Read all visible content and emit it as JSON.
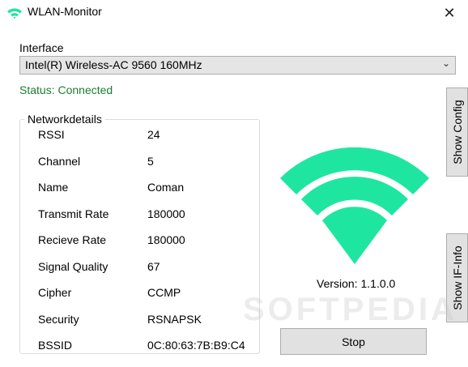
{
  "window": {
    "title": "WLAN-Monitor",
    "close_glyph": "✕"
  },
  "interface": {
    "label": "Interface",
    "selected": "Intel(R) Wireless-AC 9560 160MHz",
    "chevron": "⌄"
  },
  "status": {
    "text": "Status: Connected",
    "color": "#1b7f2c"
  },
  "details": {
    "legend": "Networkdetails",
    "rows": [
      {
        "label": "RSSI",
        "value": "24"
      },
      {
        "label": "Channel",
        "value": "5"
      },
      {
        "label": "Name",
        "value": "Coman"
      },
      {
        "label": "Transmit Rate",
        "value": "180000"
      },
      {
        "label": "Recieve Rate",
        "value": "180000"
      },
      {
        "label": "Signal Quality",
        "value": "67"
      },
      {
        "label": "Cipher",
        "value": "CCMP"
      },
      {
        "label": "Security",
        "value": "RSNAPSK"
      },
      {
        "label": "BSSID",
        "value": "0C:80:63:7B:B9:C4"
      }
    ]
  },
  "buttons": {
    "show_config": "Show Config",
    "show_ifinfo": "Show IF-Info",
    "stop": "Stop"
  },
  "version": "Version: 1.1.0.0",
  "wifi_icon": {
    "name": "wifi-icon",
    "color": "#1ee6a0"
  },
  "watermark": "SOFTPEDIA"
}
